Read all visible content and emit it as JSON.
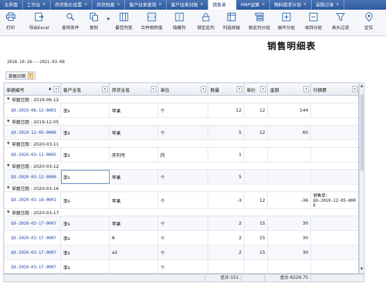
{
  "tabs": [
    {
      "label": "主界面",
      "active": false
    },
    {
      "label": "工作台",
      "active": false
    },
    {
      "label": "存货售价设置",
      "active": false
    },
    {
      "label": "存货档案",
      "active": false
    },
    {
      "label": "客户往来查询",
      "active": false
    },
    {
      "label": "客户往来对账",
      "active": false
    },
    {
      "label": "销售单",
      "active": true
    },
    {
      "label": "MRP运算",
      "active": false
    },
    {
      "label": "物料需求计划",
      "active": false
    },
    {
      "label": "采购订单",
      "active": false
    }
  ],
  "toolbar": {
    "print": "打印",
    "export": "导出Excel",
    "query": "查询条件",
    "copy": "复制",
    "best_width": "最佳列宽",
    "merge": "合并相同值",
    "hide": "隐藏列",
    "lock": "锁定此列",
    "col_selector": "列选择器",
    "group_by_col": "按此列分组",
    "expand": "展开分组",
    "collapse": "收回分组",
    "header_filter": "表头过滤",
    "locate": "定位"
  },
  "report": {
    "title": "销售明细表",
    "date_range": "2018-10-26---2021-03-08"
  },
  "group_chip": {
    "label": "单据日期"
  },
  "columns": [
    "单据编号",
    "客户全名",
    "存货全名",
    "单位",
    "数量",
    "单价",
    "金额",
    "行摘要"
  ],
  "rows": [
    {
      "type": "group",
      "label": "单据日期 : 2019-06-12"
    },
    {
      "type": "data",
      "no": "QX-2019-06-12-0001",
      "customer": "李s",
      "item": "苹果",
      "unit": "个",
      "qty": "12",
      "price": "12",
      "amount": "144",
      "memo": ""
    },
    {
      "type": "group",
      "label": "单据日期 : 2019-12-05"
    },
    {
      "type": "data",
      "no": "QX-2019-12-05-0006",
      "customer": "李s",
      "item": "苹果",
      "unit": "个",
      "qty": "5",
      "price": "12",
      "amount": "60",
      "memo": ""
    },
    {
      "type": "group",
      "label": "单据日期 : 2020-03-11"
    },
    {
      "type": "data",
      "no": "QX-2020-03-11-0005",
      "customer": "李s",
      "item": "序列号",
      "unit": "的",
      "qty": "1",
      "price": "",
      "amount": "",
      "memo": ""
    },
    {
      "type": "group",
      "label": "单据日期 : 2020-03-12"
    },
    {
      "type": "data",
      "no": "QX-2020-03-12-0006",
      "customer": "李s",
      "item": "苹果",
      "unit": "个",
      "qty": "5",
      "price": "",
      "amount": "",
      "memo": "",
      "sel": true
    },
    {
      "type": "group",
      "label": "单据日期 : 2020-03-16"
    },
    {
      "type": "data",
      "no": "QX-2020-03-16-0001",
      "customer": "李s",
      "item": "苹果",
      "unit": "个",
      "qty": "-3",
      "price": "12",
      "amount": "-36",
      "memo": "销售单:\nQX-2019-12-05-0006",
      "tall": true
    },
    {
      "type": "group",
      "label": "单据日期 : 2020-03-17"
    },
    {
      "type": "data",
      "no": "QX-2020-03-17-0007",
      "customer": "李s",
      "item": "苹果",
      "unit": "个",
      "qty": "2",
      "price": "15",
      "amount": "30",
      "memo": ""
    },
    {
      "type": "data",
      "no": "QX-2020-03-17-0007",
      "customer": "李s",
      "item": "A",
      "unit": "个",
      "qty": "2",
      "price": "15",
      "amount": "30",
      "memo": ""
    },
    {
      "type": "data",
      "no": "QX-2020-03-17-0007",
      "customer": "李s",
      "item": "a2",
      "unit": "个",
      "qty": "2",
      "price": "15",
      "amount": "30",
      "memo": ""
    },
    {
      "type": "data",
      "no": "QX-2020-03-17-0007",
      "customer": "李s",
      "item": "",
      "unit": "个",
      "qty": "",
      "price": "",
      "amount": "",
      "memo": ""
    }
  ],
  "footer": {
    "qty_total": "总计:151",
    "amount_total": "总计:6229.75"
  }
}
